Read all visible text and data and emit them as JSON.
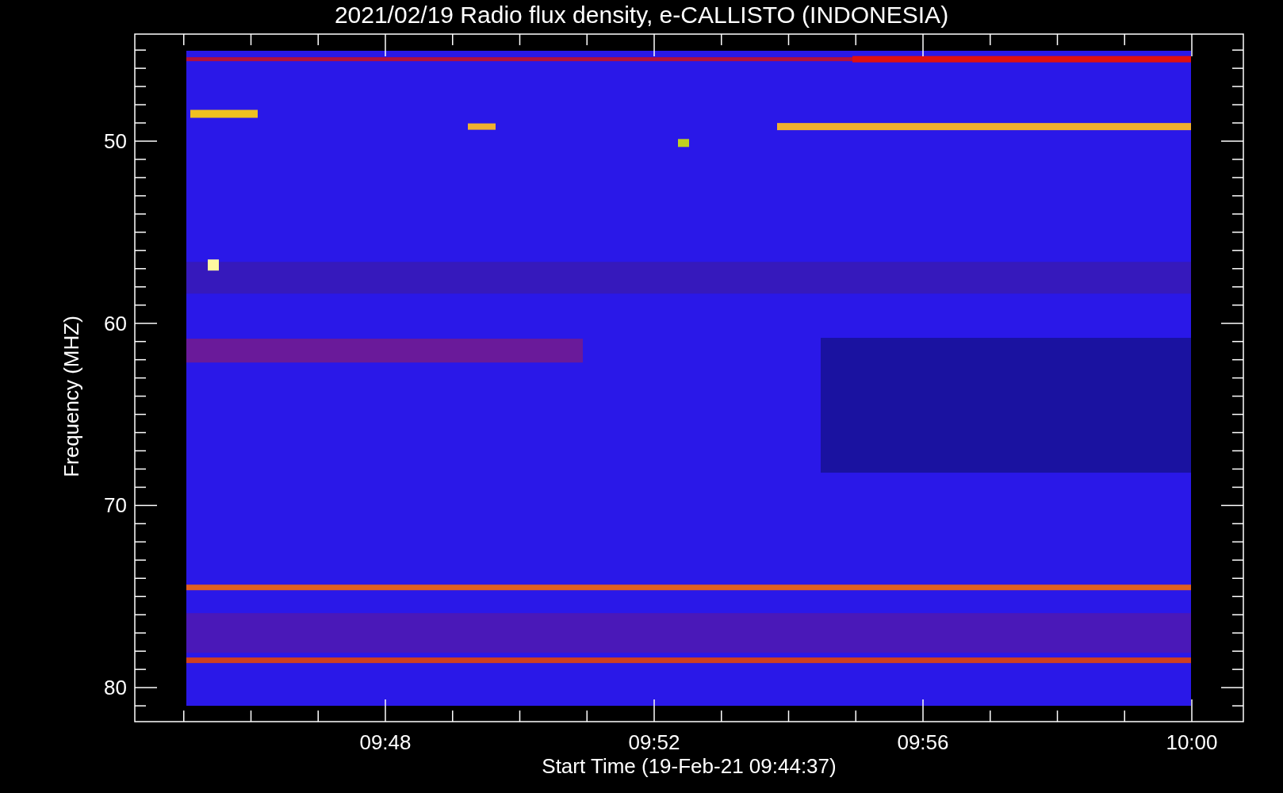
{
  "title": "2021/02/19  Radio flux density, e-CALLISTO (INDONESIA)",
  "y_axis": {
    "label": "Frequency (MHZ)",
    "ticks": [
      "50",
      "60",
      "70",
      "80"
    ]
  },
  "x_axis": {
    "label": "Start Time (19-Feb-21 09:44:37)",
    "ticks": [
      "09:48",
      "09:52",
      "09:56",
      "10:00"
    ]
  }
}
